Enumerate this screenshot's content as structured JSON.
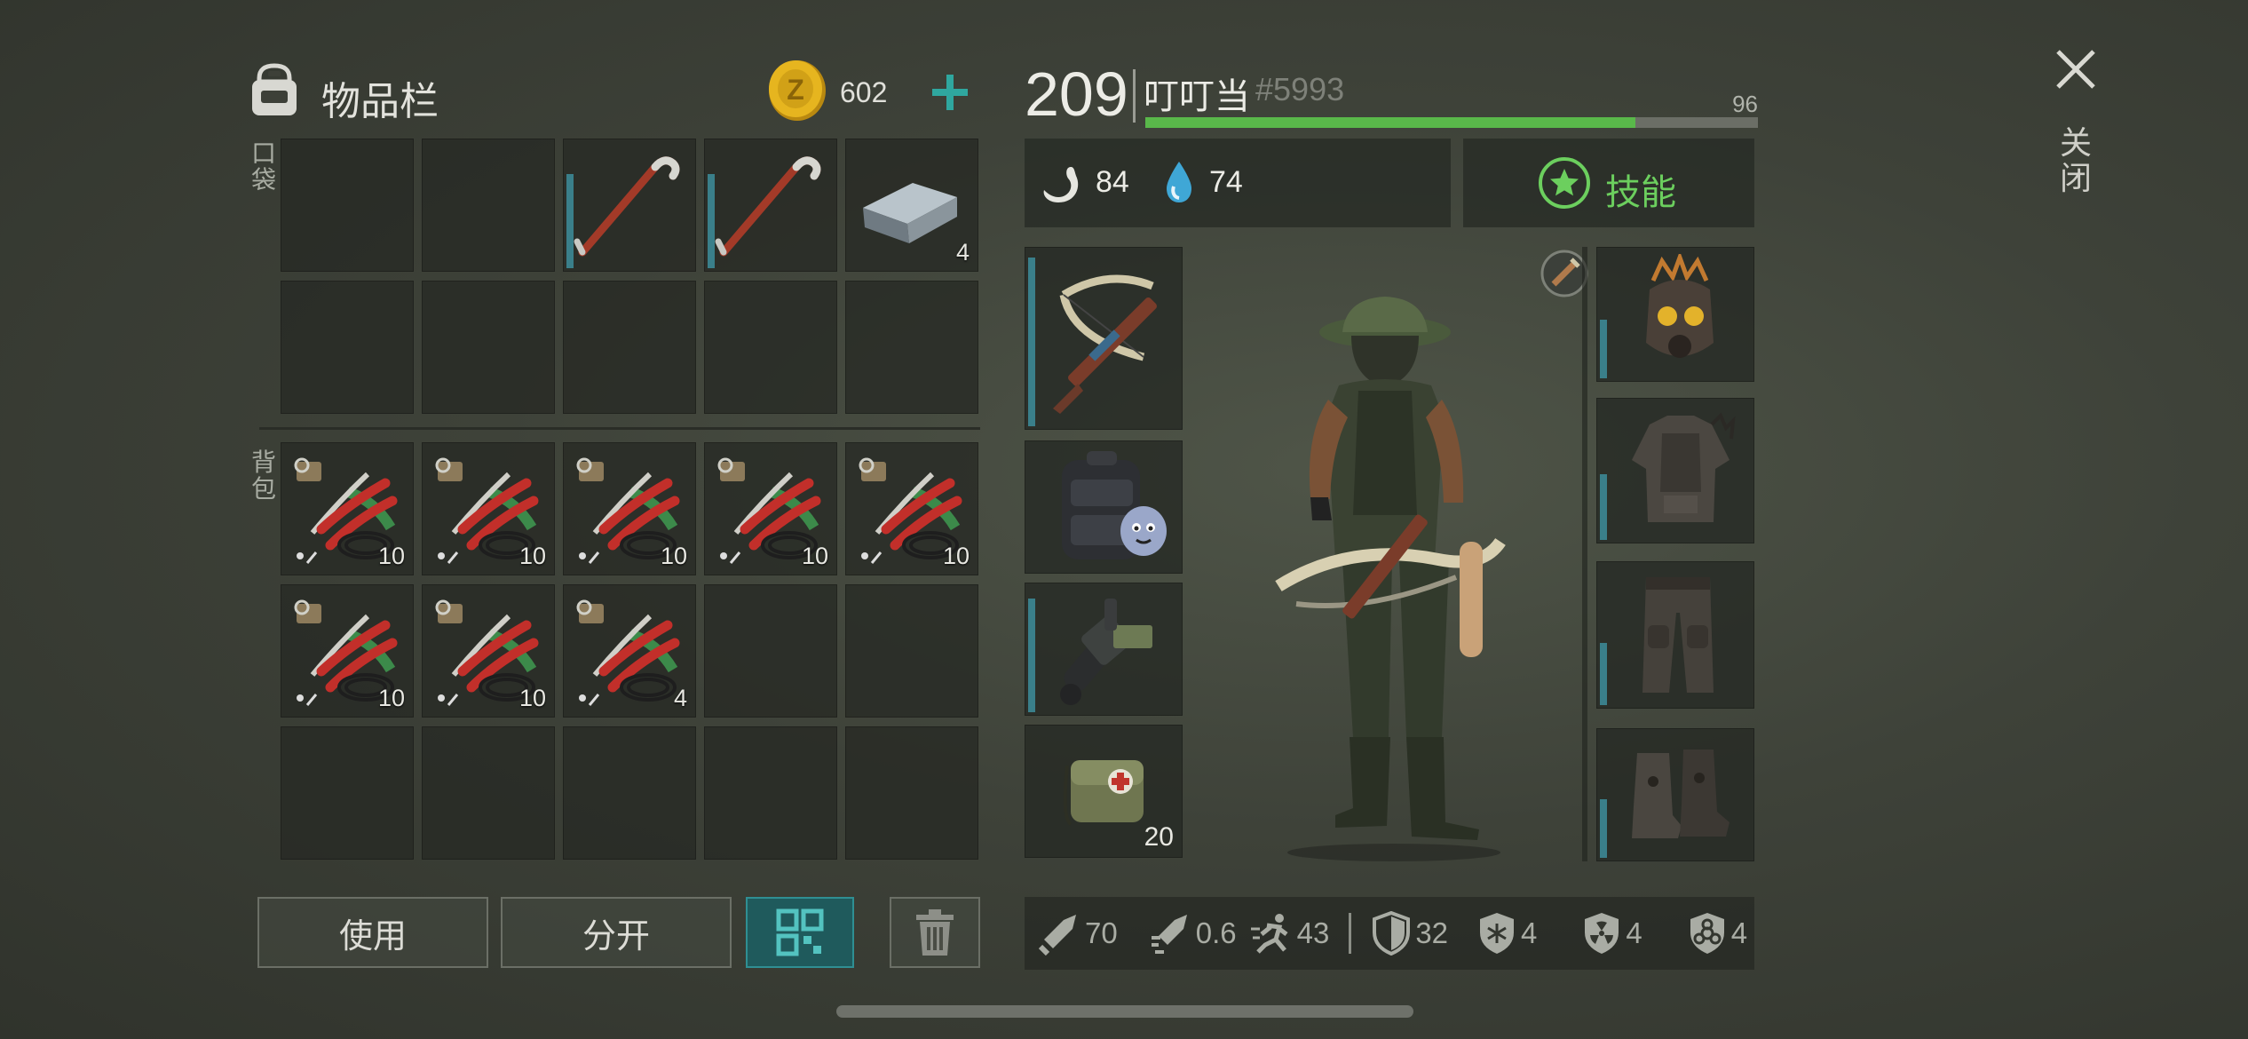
{
  "inventory": {
    "title": "物品栏",
    "coins": "602",
    "pocket_label": "口袋",
    "backpack_label": "背包",
    "pocket_slots": [
      {
        "item": "",
        "qty": ""
      },
      {
        "item": "",
        "qty": ""
      },
      {
        "item": "crowbar",
        "qty": ""
      },
      {
        "item": "crowbar",
        "qty": ""
      },
      {
        "item": "iron-ingot",
        "qty": "4"
      },
      {
        "item": "",
        "qty": ""
      },
      {
        "item": "",
        "qty": ""
      },
      {
        "item": "",
        "qty": ""
      },
      {
        "item": "",
        "qty": ""
      },
      {
        "item": "",
        "qty": ""
      }
    ],
    "backpack_slots": [
      {
        "item": "pliers-kit",
        "qty": "10"
      },
      {
        "item": "pliers-kit",
        "qty": "10"
      },
      {
        "item": "pliers-kit",
        "qty": "10"
      },
      {
        "item": "pliers-kit",
        "qty": "10"
      },
      {
        "item": "pliers-kit",
        "qty": "10"
      },
      {
        "item": "pliers-kit",
        "qty": "10"
      },
      {
        "item": "pliers-kit",
        "qty": "10"
      },
      {
        "item": "pliers-kit",
        "qty": "4"
      },
      {
        "item": "",
        "qty": ""
      },
      {
        "item": "",
        "qty": ""
      },
      {
        "item": "",
        "qty": ""
      },
      {
        "item": "",
        "qty": ""
      },
      {
        "item": "",
        "qty": ""
      },
      {
        "item": "",
        "qty": ""
      },
      {
        "item": "",
        "qty": ""
      }
    ],
    "use_label": "使用",
    "split_label": "分开"
  },
  "character": {
    "level": "209",
    "name": "叮叮当",
    "tag": "#5993",
    "xp_value": "96",
    "xp_fraction": 0.8,
    "hunger": "84",
    "thirst": "74",
    "skills_label": "技能",
    "med_kit_qty": "20"
  },
  "stats": {
    "damage": "70",
    "attack_speed": "0.6",
    "speed": "43",
    "armor": "32",
    "cold_resist": "4",
    "radiation_resist": "4",
    "bio_resist": "4"
  },
  "close_label": "关闭",
  "colors": {
    "accent_teal": "#2f8f93",
    "xp_green": "#59b84a",
    "skills_green": "#6ccf5e",
    "coin_gold": "#e2b21e"
  }
}
